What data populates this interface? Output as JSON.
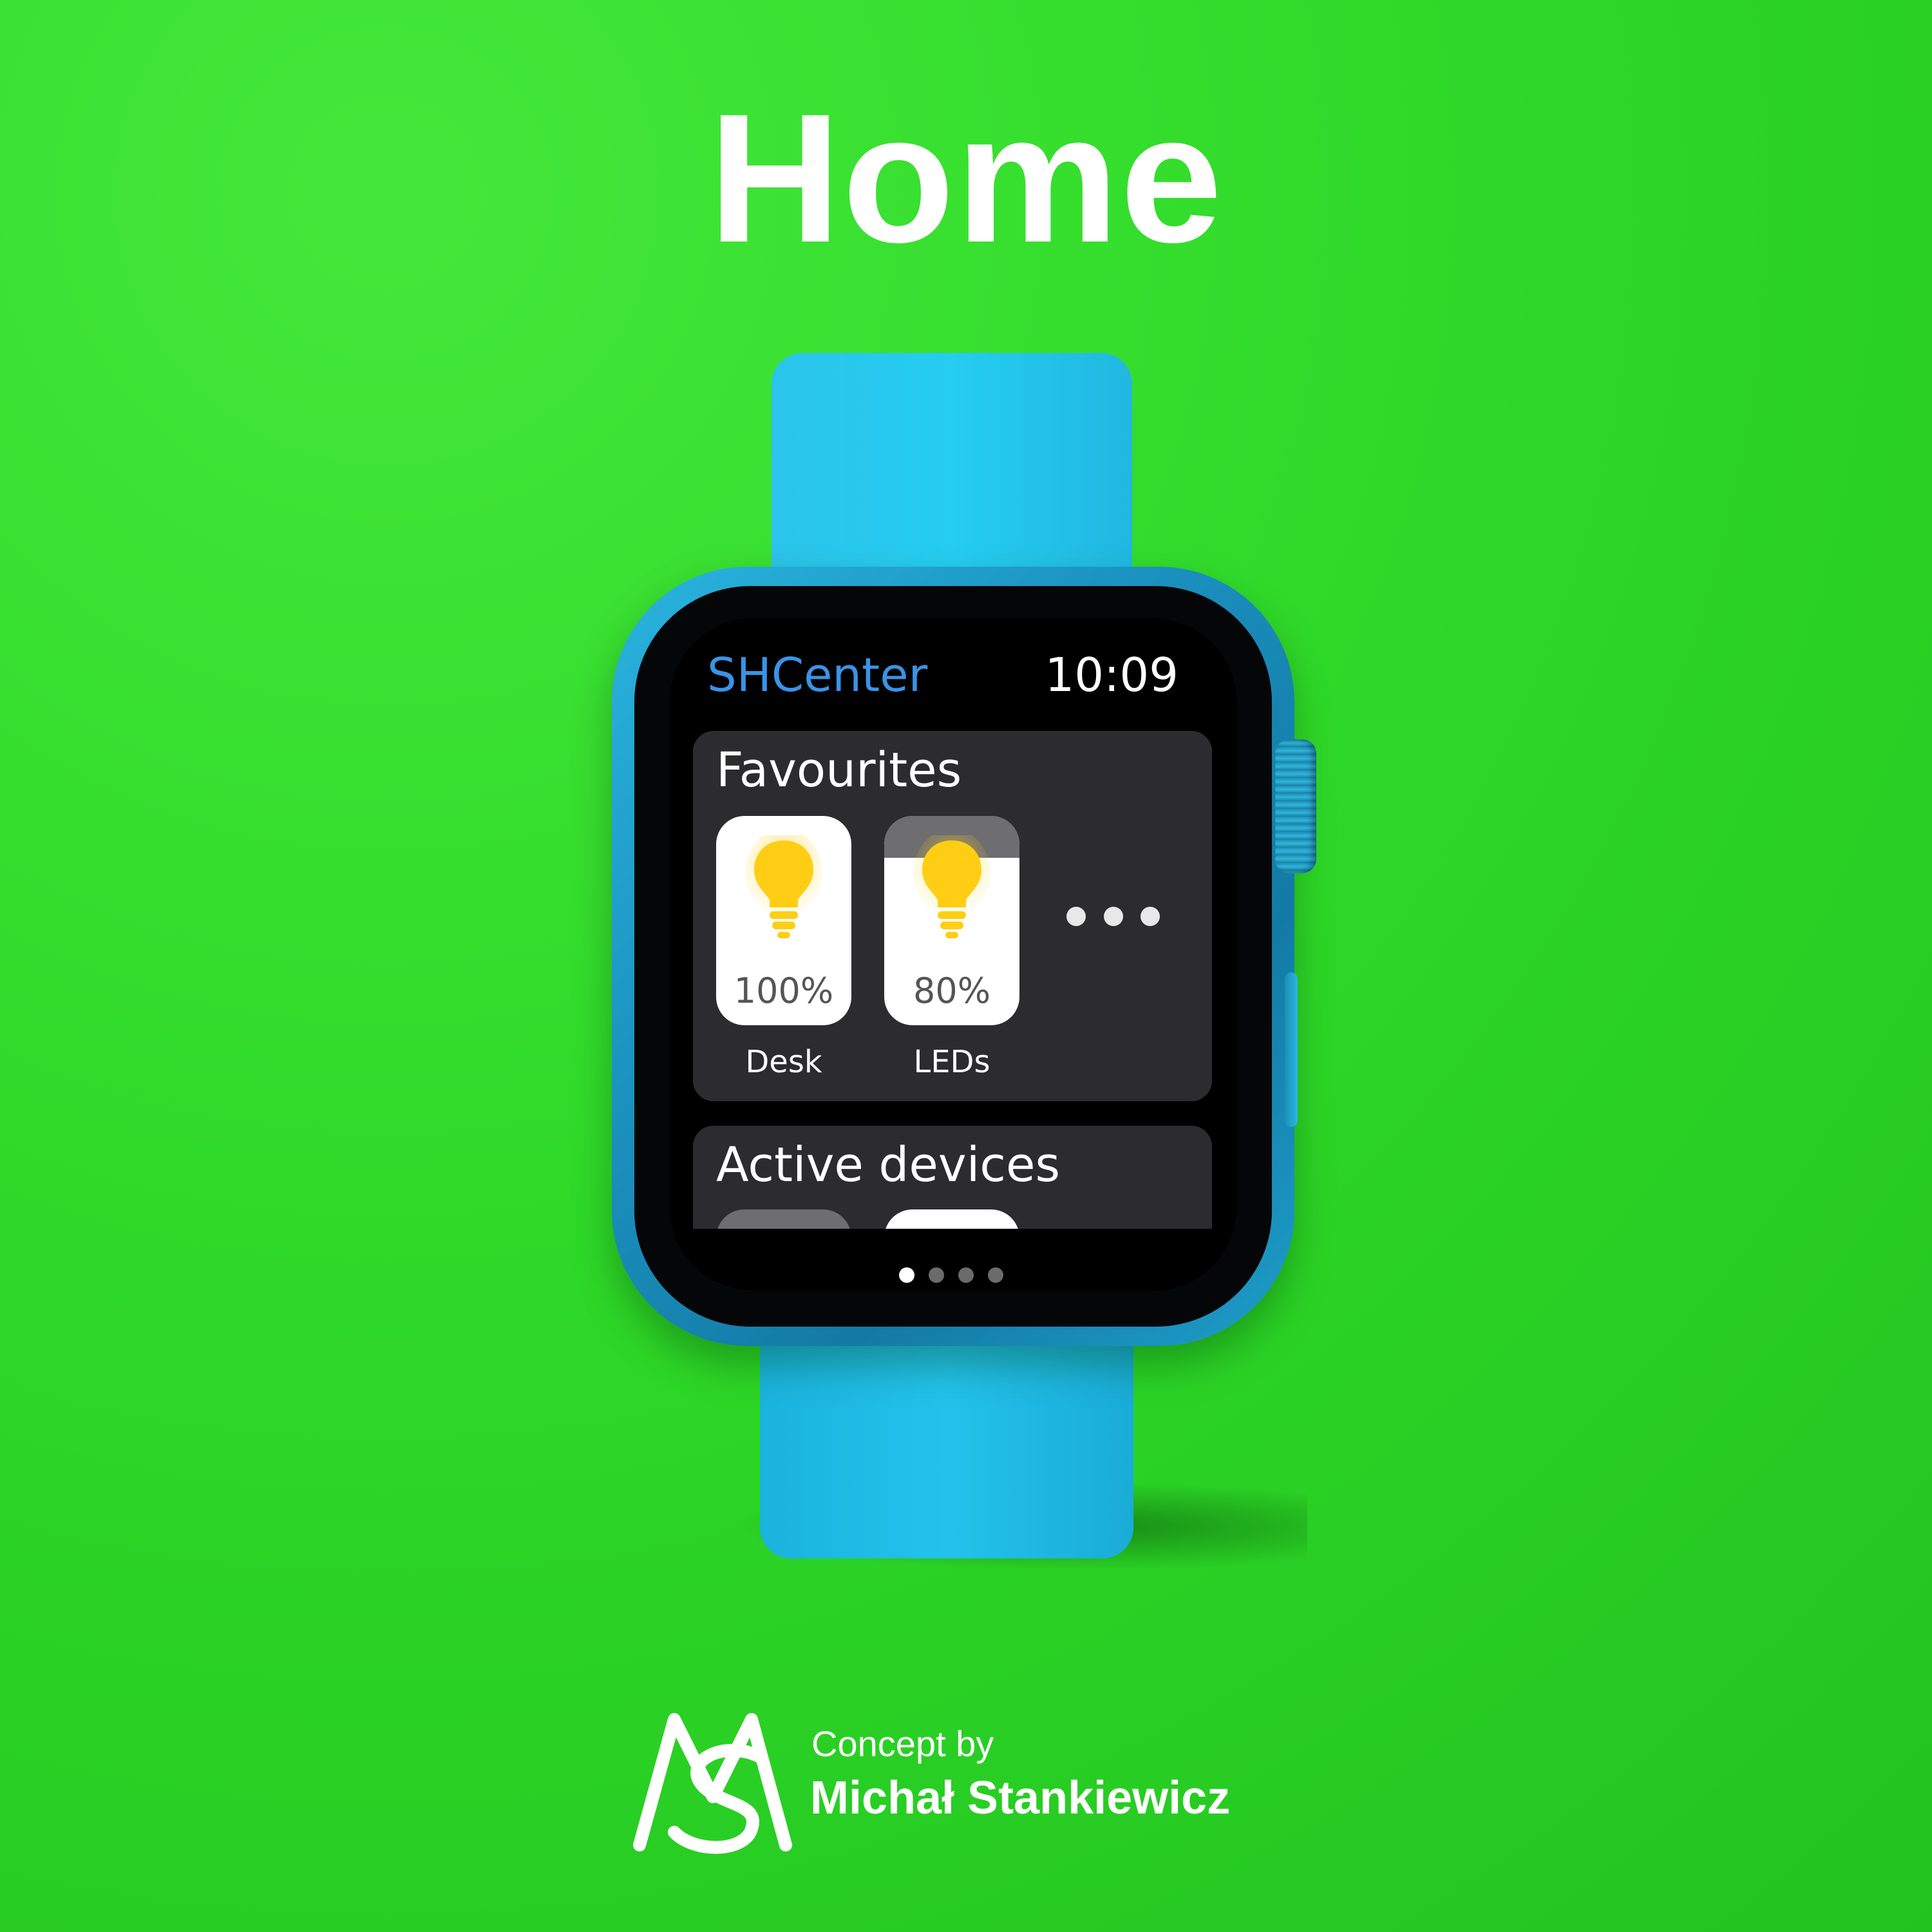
{
  "poster": {
    "headline": "Home",
    "credit_prefix": "Concept by",
    "credit_name": "Michał Stankiewicz",
    "background_color": "#2fd928",
    "band_color": "#25cdf0"
  },
  "watch_screen": {
    "app_title": "SHCenter",
    "time": "10:09",
    "accent_color": "#3a93e6",
    "favourites": {
      "title": "Favourites",
      "devices": [
        {
          "name": "Desk",
          "brightness_label": "100%",
          "brightness": 100,
          "icon": "lightbulb-icon"
        },
        {
          "name": "LEDs",
          "brightness_label": "80%",
          "brightness": 80,
          "icon": "lightbulb-icon"
        }
      ],
      "more_icon": "ellipsis-icon"
    },
    "active_devices": {
      "title": "Active devices"
    },
    "pager": {
      "pages": 4,
      "current": 1
    }
  }
}
